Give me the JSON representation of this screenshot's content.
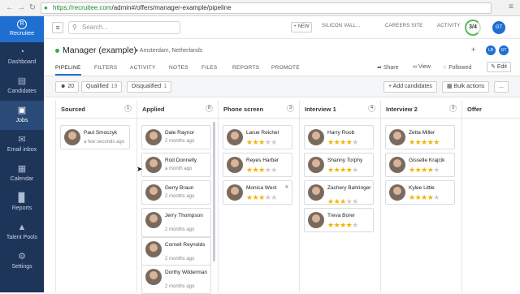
{
  "browser": {
    "url_host": "https://recruitee.com",
    "url_path": "/admin#/offers/manager-example/pipeline"
  },
  "sidebar": {
    "brand": "Recruitee",
    "items": [
      {
        "label": "Dashboard",
        "icon": "gauge-icon"
      },
      {
        "label": "Candidates",
        "icon": "candidates-icon"
      },
      {
        "label": "Jobs",
        "icon": "briefcase-icon",
        "active": true
      },
      {
        "label": "Email inbox",
        "icon": "chat-icon"
      },
      {
        "label": "Calendar",
        "icon": "calendar-icon"
      },
      {
        "label": "Reports",
        "icon": "bar-chart-icon"
      },
      {
        "label": "Talent Pools",
        "icon": "hierarchy-icon"
      },
      {
        "label": "Settings",
        "icon": "gear-icon"
      }
    ]
  },
  "topbar": {
    "search_placeholder": "Search...",
    "new_label": "+ NEW",
    "company": "SILICON VALL...",
    "careers": "CAREERS SITE",
    "activity": "ACTIVITY",
    "progress": "3/4",
    "user_initials": "GT"
  },
  "job": {
    "title": "Manager (example)",
    "location": "Amsterdam, Netherlands",
    "avatars": [
      "LB",
      "GT"
    ],
    "tabs": [
      "PIPELINE",
      "FILTERS",
      "ACTIVITY",
      "NOTES",
      "FILES",
      "REPORTS",
      "PROMOTE"
    ],
    "actions": {
      "share": "Share",
      "view": "View",
      "followed": "Followed",
      "edit": "Edit"
    }
  },
  "filters": {
    "all_count": "20",
    "qualified_label": "Qualified",
    "qualified_count": "19",
    "disqualified_label": "Disqualified",
    "disqualified_count": "1",
    "add_candidates": "+ Add candidates",
    "bulk_actions": "Bulk actions",
    "more": "..."
  },
  "columns": [
    {
      "title": "Sourced",
      "count": "1",
      "cards": [
        {
          "name": "Paul Smoczyk",
          "sub": "a few seconds ago"
        }
      ]
    },
    {
      "title": "Applied",
      "count": "8",
      "cards": [
        {
          "name": "Dale Raynor",
          "sub": "2 months ago"
        },
        {
          "name": "Rod Donnelly",
          "sub": "a month ago"
        },
        {
          "name": "Gerry Braun",
          "sub": "2 months ago"
        },
        {
          "name": "Jerry Thompson",
          "sub": "2 months ago"
        },
        {
          "name": "Cornell Reynolds",
          "sub": "2 months ago"
        },
        {
          "name": "Dorthy Wilderman",
          "sub": "2 months ago"
        }
      ]
    },
    {
      "title": "Phone screen",
      "count": "3",
      "cards": [
        {
          "name": "Larue Reichel",
          "rating": 3
        },
        {
          "name": "Reyes Harber",
          "rating": 3
        },
        {
          "name": "Monica West",
          "rating": 3
        }
      ]
    },
    {
      "title": "Interview 1",
      "count": "4",
      "cards": [
        {
          "name": "Harry Roob",
          "rating": 4
        },
        {
          "name": "Shanny Torphy",
          "rating": 4
        },
        {
          "name": "Zachery Bahringer",
          "rating": 3
        },
        {
          "name": "Treva Borer",
          "rating": 4
        }
      ]
    },
    {
      "title": "Interview 2",
      "count": "3",
      "cards": [
        {
          "name": "Zetta Miller",
          "rating": 5
        },
        {
          "name": "Gisselle Krajcik",
          "rating": 4
        },
        {
          "name": "Kylee Little",
          "rating": 4
        }
      ]
    },
    {
      "title": "Offer",
      "count": "",
      "cards": []
    }
  ]
}
